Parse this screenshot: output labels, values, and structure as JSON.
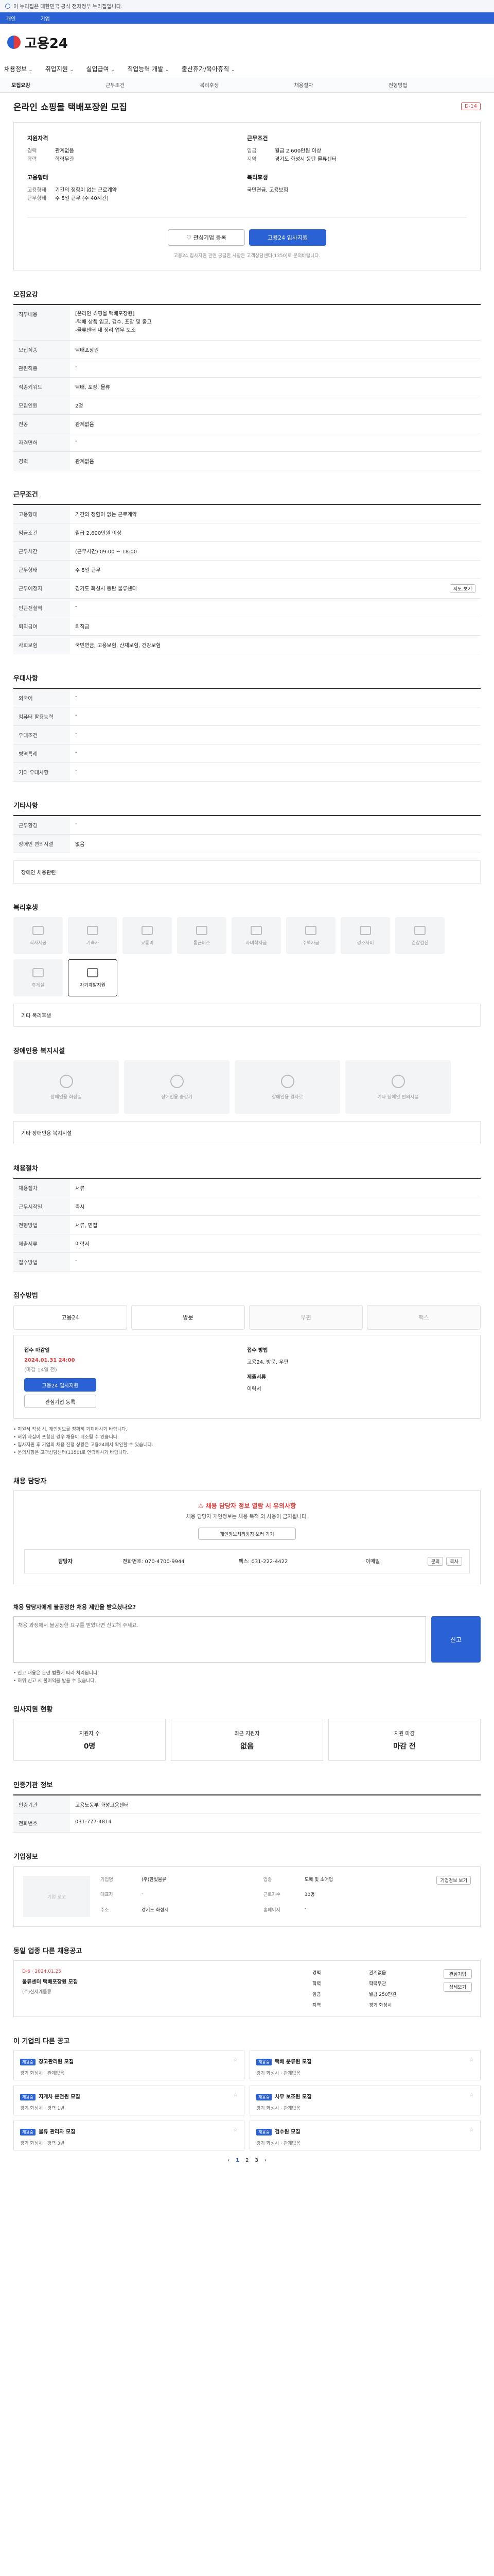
{
  "notice_bar": {
    "text": "이 누리집은 대한민국 공식 전자정부 누리집입니다."
  },
  "gov_bar": {
    "items": [
      "개인",
      "기업"
    ]
  },
  "logo": {
    "text": "고용24"
  },
  "gnb": {
    "items": [
      "채용정보",
      "취업지원",
      "실업급여",
      "직업능력 개발",
      "출산휴가/육아휴직"
    ]
  },
  "tabs": {
    "items": [
      "모집요강",
      "근무조건",
      "복리후생",
      "채용절차",
      "전형방법"
    ]
  },
  "title": "온라인 쇼핑몰 택배포장원 모집",
  "dday": "D-14",
  "summary": {
    "qual_head": "지원자격",
    "qual": [
      {
        "k": "경력",
        "v": "관계없음"
      },
      {
        "k": "학력",
        "v": "학력무관"
      }
    ],
    "cond_head": "근무조건",
    "cond": [
      {
        "k": "임금",
        "v": "월급 2,600만원 이상"
      },
      {
        "k": "지역",
        "v": "경기도 화성시 동탄 물류센터"
      }
    ],
    "type_head": "고용형태",
    "type": [
      {
        "k": "고용형태",
        "v": "기간의 정함이 없는 근로계약"
      },
      {
        "k": "근무형태",
        "v": "주 5일 근무 (주 40시간)"
      }
    ],
    "welfare_head": "복리후생",
    "welfare": "국민연금, 고용보험"
  },
  "buttons": {
    "interest": "관심기업 등록",
    "apply": "고용24 입사지원"
  },
  "note": "고용24 입사지원 관련 궁금한 사항은 고객상담센터(1350)로 문의바랍니다.",
  "sec_recruit": "모집요강",
  "recruit": {
    "rows": [
      {
        "k": "직무내용",
        "v": "[온라인 쇼핑몰 택배포장원]\n-택배 상품 입고, 검수, 포장 및 출고\n-물류센터 내 정리 업무 보조"
      },
      {
        "k": "모집직종",
        "v": "택배포장원"
      },
      {
        "k": "관련직종",
        "v": "-"
      },
      {
        "k": "직종키워드",
        "v": "택배, 포장, 물류"
      },
      {
        "k": "모집인원",
        "v": "2명"
      },
      {
        "k": "전공",
        "v": "관계없음"
      },
      {
        "k": "자격면허",
        "v": "-"
      },
      {
        "k": "경력",
        "v": "관계없음"
      }
    ]
  },
  "sec_condition": "근무조건",
  "condition": {
    "rows": [
      {
        "k": "고용형태",
        "v": "기간의 정함이 없는 근로계약"
      },
      {
        "k": "임금조건",
        "v": "월급 2,600만원 이상"
      },
      {
        "k": "근무시간",
        "v": "(근무시간) 09:00 ~ 18:00"
      },
      {
        "k": "근무형태",
        "v": "주 5일 근무"
      },
      {
        "k": "근무예정지",
        "v": "경기도 화성시 동탄 물류센터"
      },
      {
        "k": "인근전철역",
        "v": "-"
      },
      {
        "k": "퇴직급여",
        "v": "퇴직금"
      },
      {
        "k": "사회보험",
        "v": "국민연금, 고용보험, 산재보험, 건강보험"
      }
    ],
    "map_label": "지도 보기"
  },
  "sec_pref": "우대사항",
  "pref": {
    "rows": [
      {
        "k": "외국어",
        "v": "-"
      },
      {
        "k": "컴퓨터 활용능력",
        "v": "-"
      },
      {
        "k": "우대조건",
        "v": "-"
      },
      {
        "k": "병역특례",
        "v": "-"
      },
      {
        "k": "기타 우대사항",
        "v": "-"
      }
    ]
  },
  "sec_etc": "기타사항",
  "etc": {
    "rows": [
      {
        "k": "근무환경",
        "v": "-"
      },
      {
        "k": "장애인 편의시설",
        "v": "없음"
      }
    ]
  },
  "etc_note": "장애인 채용관련",
  "sec_welfare": "복리후생",
  "welfare_icons": [
    "식사제공",
    "기숙사",
    "교통비",
    "통근버스",
    "자녀학자금",
    "주택자금",
    "경조사비",
    "건강검진",
    "휴게실",
    "자기계발지원"
  ],
  "welfare_active": 9,
  "welfare_text_head": "기타 복리후생",
  "sec_disabled": "장애인용 복지시설",
  "disabled_icons": [
    "장애인용 화장실",
    "장애인용 승강기",
    "장애인용 경사로",
    "기타 장애인 편의시설"
  ],
  "disabled_text_head": "기타 장애인용 복지시설",
  "sec_process": "채용절차",
  "process": {
    "rows": [
      {
        "k": "채용절차",
        "v": "서류"
      },
      {
        "k": "근무시작일",
        "v": "즉시"
      },
      {
        "k": "전형방법",
        "v": "서류, 면접"
      },
      {
        "k": "제출서류",
        "v": "이력서"
      },
      {
        "k": "접수방법",
        "v": "-"
      }
    ]
  },
  "sec_method": "접수방법",
  "methods": [
    "고용24",
    "방문",
    "우편",
    "팩스"
  ],
  "deadline": {
    "head1": "접수 마감일",
    "date": "2024.01.31 24:00",
    "left": "(마감 14일 전)",
    "apply": "고용24 입사지원",
    "interest": "관심기업 등록",
    "head2": "접수 방법",
    "v2": "고용24, 방문, 우편",
    "head3": "제출서류",
    "v3": "이력서"
  },
  "bullets": [
    "지원서 작성 시, 개인정보를 정확히 기재하시기 바랍니다.",
    "허위 사실이 포함된 경우 채용이 취소될 수 있습니다.",
    "입사지원 후 기업의 채용 진행 상황은 고용24에서 확인할 수 있습니다.",
    "문의사항은 고객상담센터(1350)로 연락하시기 바랍니다."
  ],
  "sec_contact": "채용 담당자",
  "contact_warn": {
    "head": "채용 담당자 정보 열람 시 유의사항",
    "body": "채용 담당자 개인정보는 채용 목적 외 사용이 금지됩니다.",
    "btn": "개인정보처리방침 보러 가기"
  },
  "contact": {
    "name": "담당자",
    "tel": "전화번호: 070-4700-9944",
    "fax": "팩스: 031-222-4422",
    "email": "이메일",
    "btn1": "문의",
    "btn2": "복사"
  },
  "sec_report": "채용 담당자에게 불공정한 채용 제안을 받으셨나요?",
  "report": {
    "placeholder": "채용 과정에서 불공정한 요구를 받았다면 신고해 주세요.",
    "btn": "신고"
  },
  "report_bullets": [
    "신고 내용은 관련 법률에 따라 처리됩니다.",
    "허위 신고 시 불이익을 받을 수 있습니다."
  ],
  "sec_status": "입사지원 현황",
  "status": [
    {
      "k": "지원자 수",
      "v": "0명"
    },
    {
      "k": "최근 지원자",
      "v": "없음"
    },
    {
      "k": "지원 마감",
      "v": "마감 전"
    }
  ],
  "sec_office": "인증기관 정보",
  "office": {
    "rows": [
      {
        "k": "인증기관",
        "v": "고용노동부 화성고용센터"
      },
      {
        "k": "전화번호",
        "v": "031-777-4814"
      }
    ]
  },
  "sec_company": "기업정보",
  "company": {
    "logo": "기업 로고",
    "rows": [
      {
        "k": "기업명",
        "v": "(주)한빛물류"
      },
      {
        "k": "업종",
        "v": "도매 및 소매업"
      },
      {
        "k": "대표자",
        "v": "-"
      },
      {
        "k": "근로자수",
        "v": "30명"
      },
      {
        "k": "주소",
        "v": "경기도 화성시"
      },
      {
        "k": "홈페이지",
        "v": "-"
      }
    ],
    "btn": "기업정보 보기"
  },
  "sec_same": "동일 업종 다른 채용공고",
  "same": {
    "date": "D-6 · 2024.01.25",
    "title": "물류센터 택배포장원 모집",
    "company": "(주)신세계물류",
    "r": [
      {
        "k": "경력",
        "v": "관계없음"
      },
      {
        "k": "학력",
        "v": "학력무관"
      },
      {
        "k": "임금",
        "v": "월급 250만원"
      },
      {
        "k": "지역",
        "v": "경기 화성시"
      }
    ],
    "acts": [
      "관심기업",
      "상세보기"
    ]
  },
  "sec_other": "이 기업의 다른 공고",
  "cards": [
    {
      "tag": "채용중",
      "title": "창고관리원 모집",
      "meta": "경기 화성시 · 관계없음"
    },
    {
      "tag": "채용중",
      "title": "택배 분류원 모집",
      "meta": "경기 화성시 · 관계없음"
    },
    {
      "tag": "채용중",
      "title": "지게차 운전원 모집",
      "meta": "경기 화성시 · 경력 1년"
    },
    {
      "tag": "채용중",
      "title": "사무 보조원 모집",
      "meta": "경기 화성시 · 관계없음"
    },
    {
      "tag": "채용중",
      "title": "물류 관리자 모집",
      "meta": "경기 화성시 · 경력 3년"
    },
    {
      "tag": "채용중",
      "title": "검수원 모집",
      "meta": "경기 화성시 · 관계없음"
    }
  ],
  "pager": [
    "1",
    "2",
    "3"
  ]
}
